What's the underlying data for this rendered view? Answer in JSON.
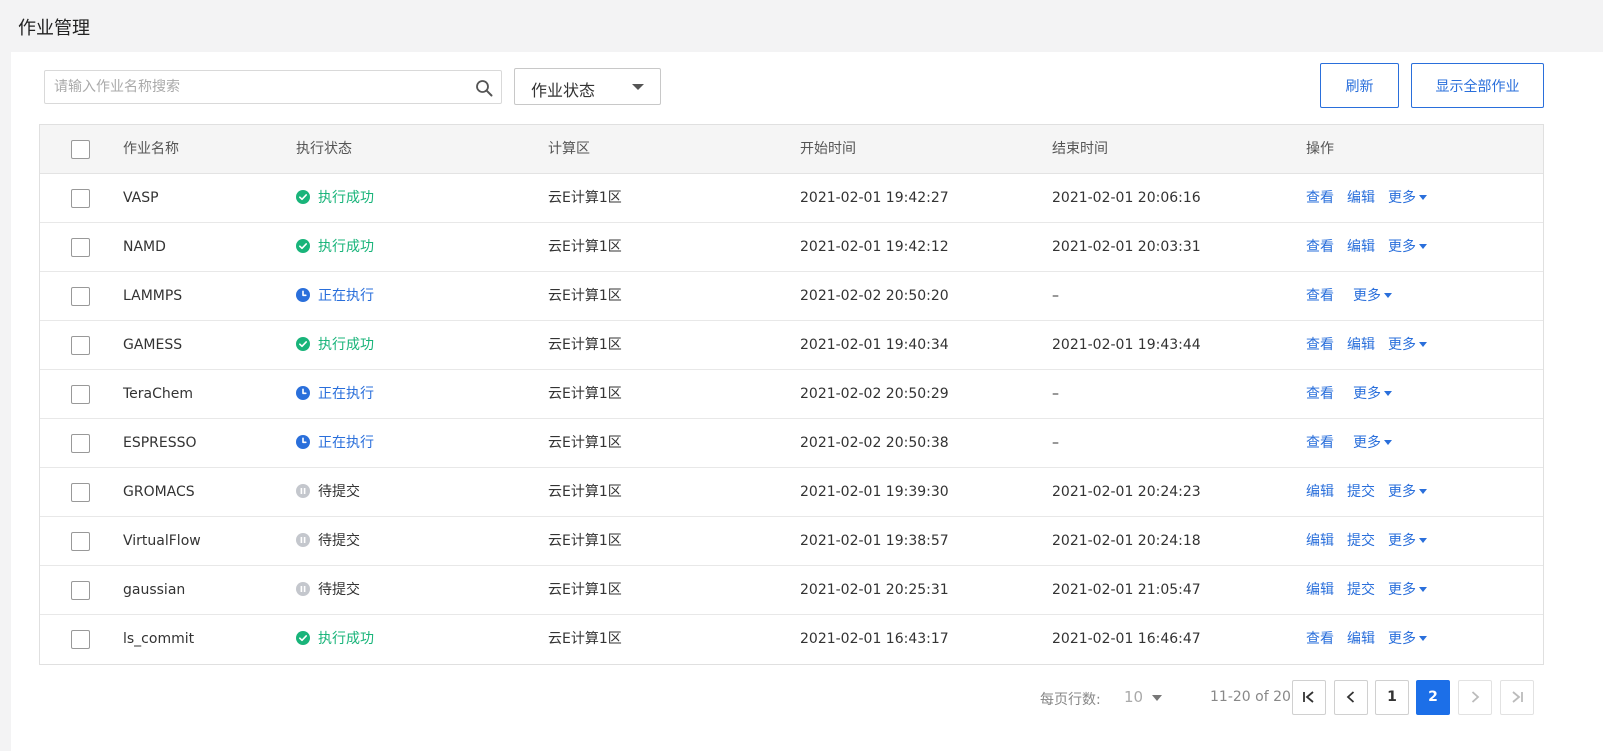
{
  "header": {
    "title": "作业管理"
  },
  "toolbar": {
    "search_placeholder": "请输入作业名称搜索",
    "status_filter_label": "作业状态",
    "refresh_label": "刷新",
    "show_all_label": "显示全部作业"
  },
  "table": {
    "columns": {
      "name": "作业名称",
      "status": "执行状态",
      "zone": "计算区",
      "start": "开始时间",
      "end": "结束时间",
      "ops": "操作"
    },
    "rows": [
      {
        "name": "VASP",
        "status": "执行成功",
        "zone": "云E计算1区",
        "start": "2021-02-01 19:42:27",
        "end": "2021-02-01 20:06:16",
        "op1": "查看",
        "op2": "编辑",
        "more": "更多"
      },
      {
        "name": "NAMD",
        "status": "执行成功",
        "zone": "云E计算1区",
        "start": "2021-02-01 19:42:12",
        "end": "2021-02-01 20:03:31",
        "op1": "查看",
        "op2": "编辑",
        "more": "更多"
      },
      {
        "name": "LAMMPS",
        "status": "正在执行",
        "zone": "云E计算1区",
        "start": "2021-02-02 20:50:20",
        "end": "–",
        "op1": "查看",
        "more": "更多"
      },
      {
        "name": "GAMESS",
        "status": "执行成功",
        "zone": "云E计算1区",
        "start": "2021-02-01 19:40:34",
        "end": "2021-02-01 19:43:44",
        "op1": "查看",
        "op2": "编辑",
        "more": "更多"
      },
      {
        "name": "TeraChem",
        "status": "正在执行",
        "zone": "云E计算1区",
        "start": "2021-02-02 20:50:29",
        "end": "–",
        "op1": "查看",
        "more": "更多"
      },
      {
        "name": "ESPRESSO",
        "status": "正在执行",
        "zone": "云E计算1区",
        "start": "2021-02-02 20:50:38",
        "end": "–",
        "op1": "查看",
        "more": "更多"
      },
      {
        "name": "GROMACS",
        "status": "待提交",
        "zone": "云E计算1区",
        "start": "2021-02-01 19:39:30",
        "end": "2021-02-01 20:24:23",
        "op1": "编辑",
        "op2": "提交",
        "more": "更多"
      },
      {
        "name": "VirtualFlow",
        "status": "待提交",
        "zone": "云E计算1区",
        "start": "2021-02-01 19:38:57",
        "end": "2021-02-01 20:24:18",
        "op1": "编辑",
        "op2": "提交",
        "more": "更多"
      },
      {
        "name": "gaussian",
        "status": "待提交",
        "zone": "云E计算1区",
        "start": "2021-02-01 20:25:31",
        "end": "2021-02-01 21:05:47",
        "op1": "编辑",
        "op2": "提交",
        "more": "更多"
      },
      {
        "name": "ls_commit",
        "status": "执行成功",
        "zone": "云E计算1区",
        "start": "2021-02-01 16:43:17",
        "end": "2021-02-01 16:46:47",
        "op1": "查看",
        "op2": "编辑",
        "more": "更多"
      }
    ]
  },
  "pagination": {
    "rows_per_page_label": "每页行数:",
    "rows_per_page": "10",
    "range": "11-20 of 20",
    "pages": [
      "1",
      "2"
    ],
    "current_page": "2"
  },
  "colors": {
    "accent": "#2a6fdb",
    "success": "#19b47a",
    "pending": "#b0b4bc"
  }
}
